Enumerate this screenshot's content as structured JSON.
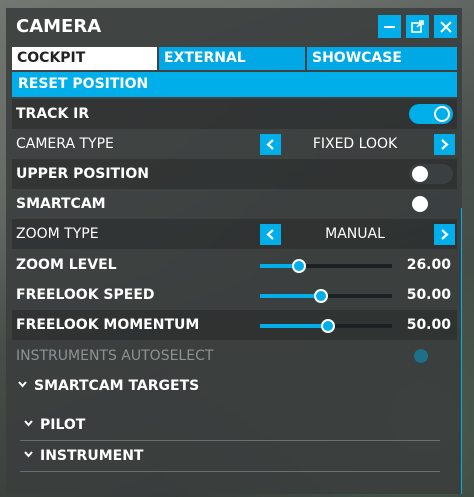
{
  "window": {
    "title": "CAMERA"
  },
  "tabs": [
    {
      "label": "COCKPIT",
      "active": true
    },
    {
      "label": "EXTERNAL",
      "active": false
    },
    {
      "label": "SHOWCASE",
      "active": false
    }
  ],
  "reset_label": "RESET POSITION",
  "settings": {
    "track_ir": {
      "label": "TRACK IR",
      "enabled": true
    },
    "camera_type": {
      "label": "CAMERA TYPE",
      "value": "FIXED LOOK"
    },
    "upper_position": {
      "label": "UPPER POSITION",
      "enabled": false
    },
    "smartcam": {
      "label": "SMARTCAM",
      "enabled": false
    },
    "zoom_type": {
      "label": "ZOOM TYPE",
      "value": "MANUAL"
    },
    "zoom_level": {
      "label": "ZOOM LEVEL",
      "value": "26.00",
      "fraction": 0.28
    },
    "freelook_speed": {
      "label": "FREELOOK SPEED",
      "value": "50.00",
      "fraction": 0.45
    },
    "freelook_momentum": {
      "label": "FREELOOK MOMENTUM",
      "value": "50.00",
      "fraction": 0.5
    },
    "instruments_autoselect": {
      "label": "INSTRUMENTS AUTOSELECT",
      "disabled": true
    }
  },
  "sections": {
    "smartcam_targets": "SMARTCAM TARGETS",
    "pilot": "PILOT",
    "instrument": "INSTRUMENT"
  },
  "icons": {
    "minimize": "minimize-icon",
    "popout": "popout-icon",
    "close": "close-icon"
  },
  "colors": {
    "accent": "#00aeea",
    "panel": "#3a3e3e"
  }
}
